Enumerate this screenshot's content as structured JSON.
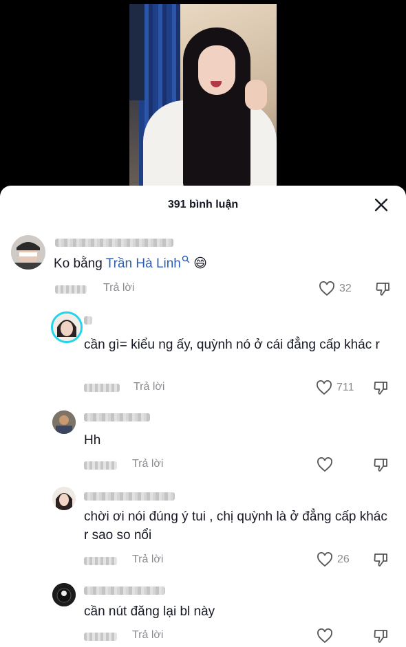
{
  "header": {
    "title": "391 bình luận"
  },
  "comments": [
    {
      "text_prefix": "Ko bằng",
      "mention": "Trần Hà Linh",
      "emoji": "😄",
      "reply": "Trả lời",
      "likes": "32"
    },
    {
      "text": "cần gì= kiểu ng ấy, quỳnh nó ở cái đẳng cấp khác r",
      "reply": "Trả lời",
      "likes": "711"
    },
    {
      "text": "Hh",
      "reply": "Trả lời",
      "likes": ""
    },
    {
      "text": "chời ơi nói đúng ý tui , chị quỳnh là ở đẳng cấp khác r sao so nổi",
      "reply": "Trả lời",
      "likes": "26"
    },
    {
      "text": "cần nút đăng lại bl này",
      "reply": "Trả lời",
      "likes": ""
    }
  ],
  "icons": {
    "close": "close-icon",
    "like": "heart-outline-icon",
    "dislike": "thumbs-down-icon",
    "mention": "search-icon"
  },
  "colors": {
    "mention": "#2b5db5",
    "story_ring": "#20d5ec",
    "muted": "#8a8b91"
  }
}
